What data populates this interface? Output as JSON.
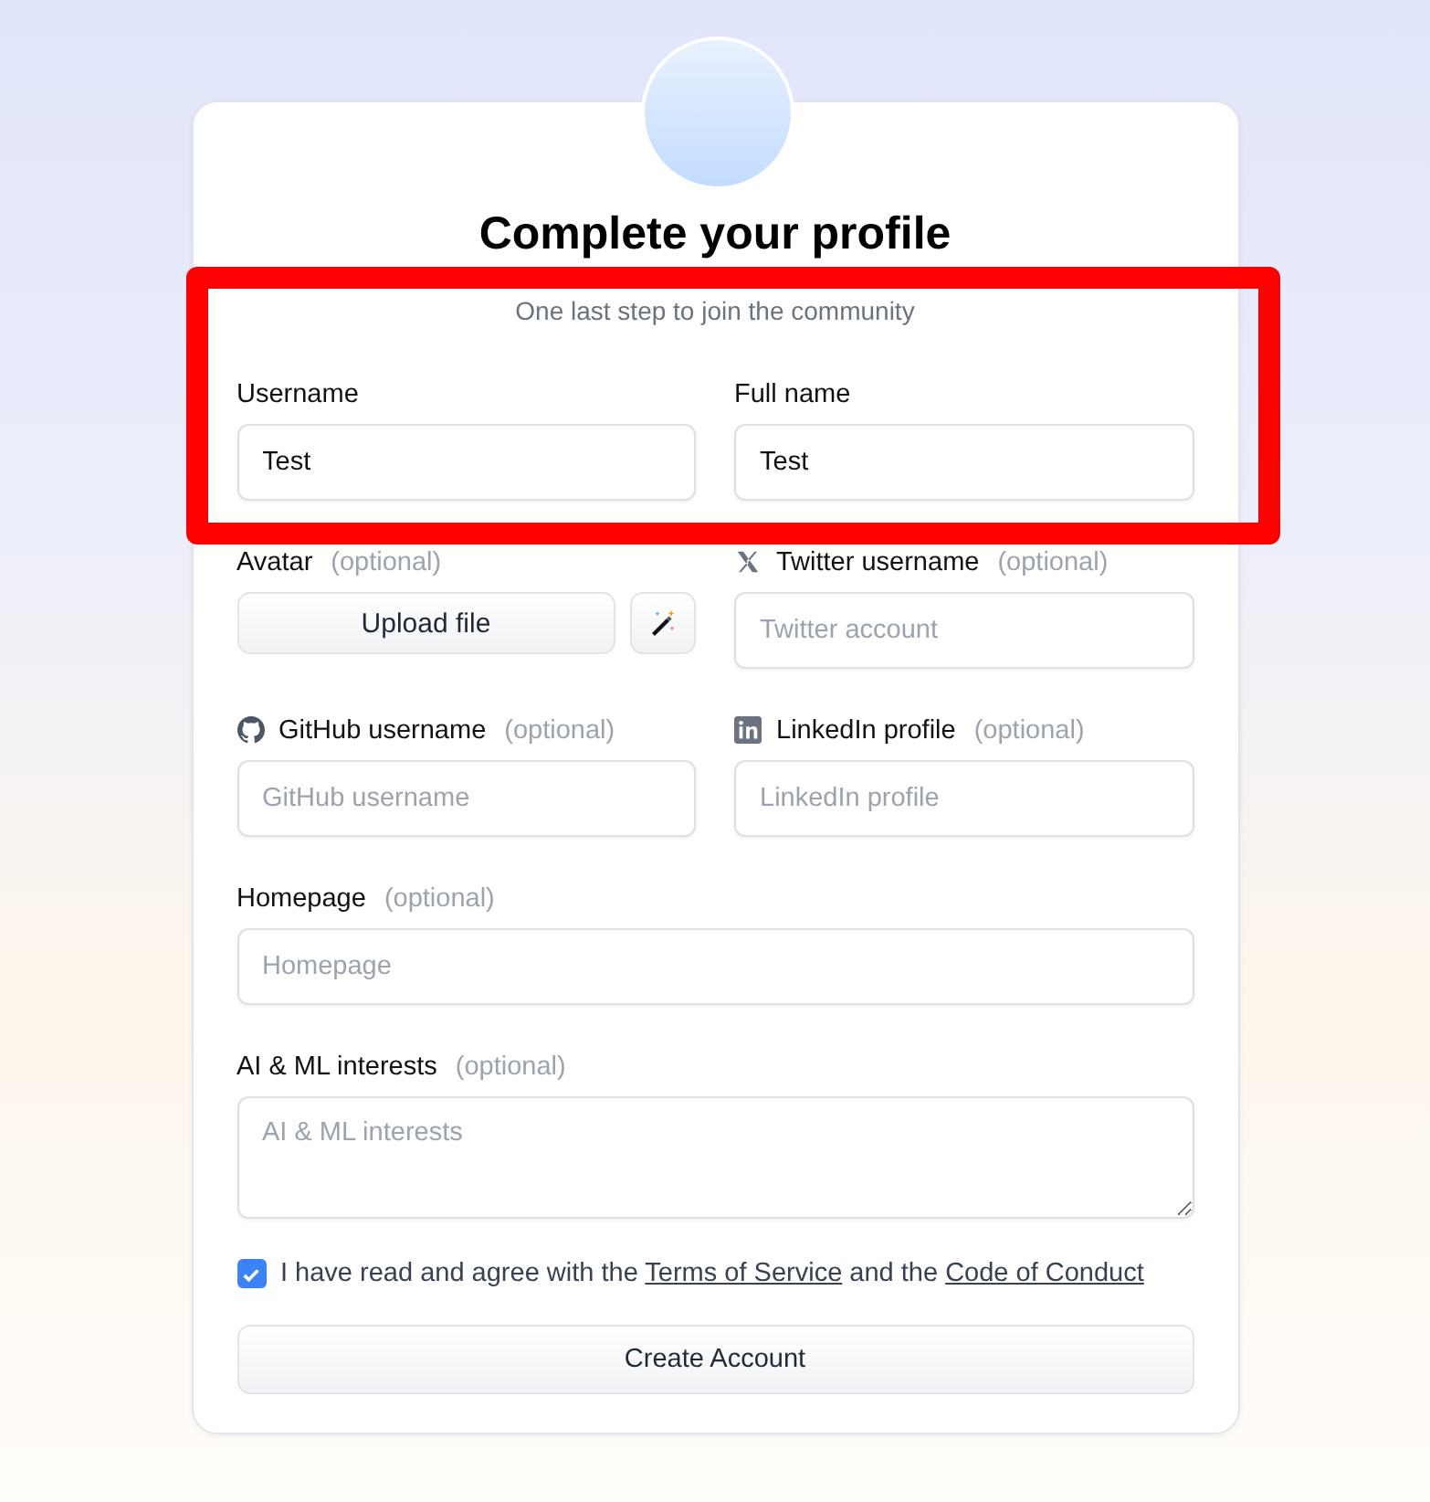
{
  "title": "Complete your profile",
  "subtitle": "One last step to join the community",
  "highlight": true,
  "rows": [
    [
      {
        "kind": "text",
        "label": "Username",
        "value": "Test"
      },
      {
        "kind": "text",
        "label": "Full name",
        "value": "Test"
      }
    ],
    [
      {
        "kind": "upload",
        "label": "Avatar",
        "optional": "(optional)",
        "button": "Upload file"
      },
      {
        "kind": "twitter",
        "label": "Twitter username",
        "optional": "(optional)",
        "placeholder": "Twitter account"
      }
    ],
    [
      {
        "kind": "github",
        "label": "GitHub username",
        "optional": "(optional)",
        "placeholder": "GitHub username"
      },
      {
        "kind": "linkedin",
        "label": "LinkedIn profile",
        "optional": "(optional)",
        "placeholder": "LinkedIn profile"
      }
    ],
    [
      {
        "kind": "text",
        "label": "Homepage",
        "optional": "(optional)",
        "placeholder": "Homepage"
      }
    ],
    [
      {
        "kind": "textarea",
        "label": "AI & ML interests",
        "optional": "(optional)",
        "placeholder": "AI & ML interests"
      }
    ]
  ],
  "agreement": {
    "checked": true,
    "parts": [
      {
        "kind": "text",
        "text": "I have read and agree with the "
      },
      {
        "kind": "link",
        "text": "Terms of Service"
      },
      {
        "kind": "text",
        "text": " and the "
      },
      {
        "kind": "link",
        "text": "Code of Conduct"
      }
    ]
  },
  "submit": "Create Account"
}
